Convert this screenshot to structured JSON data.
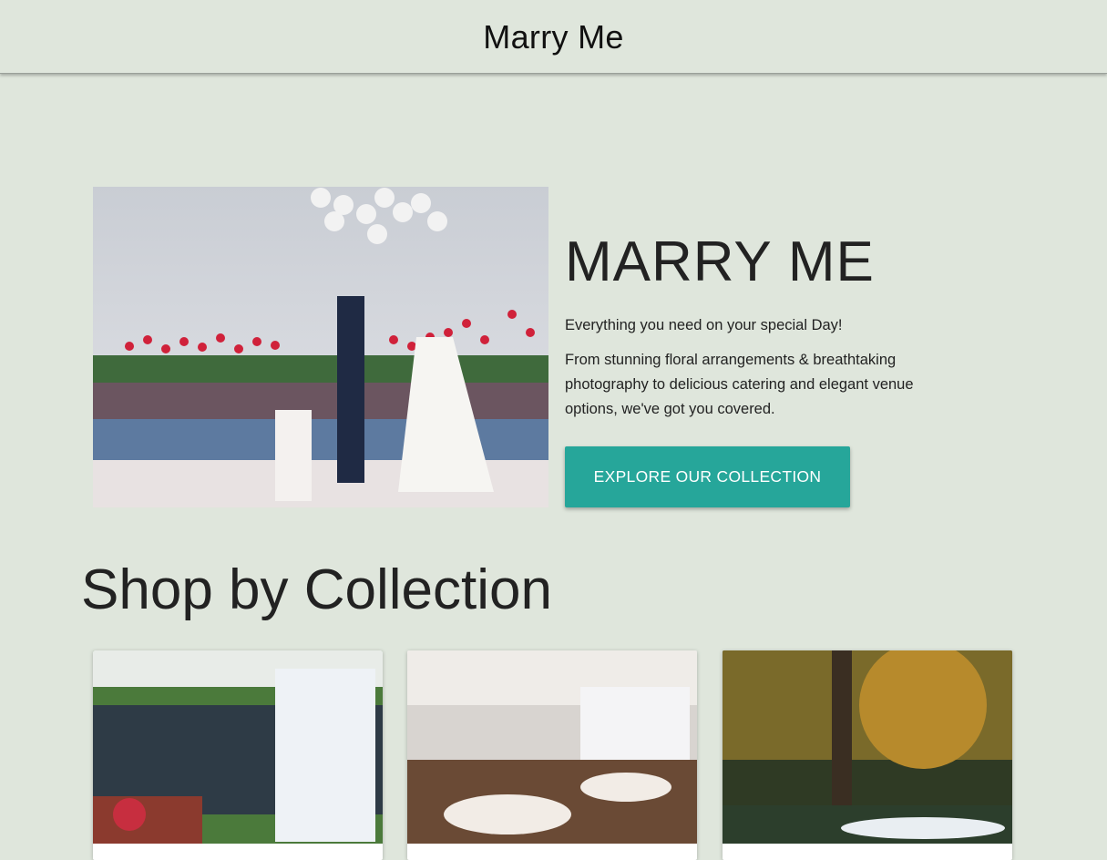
{
  "header": {
    "brand": "Marry Me"
  },
  "hero": {
    "title": "MARRY ME",
    "tagline": "Everything you need on your special Day!",
    "description": "From stunning floral arrangements & breathtaking photography to delicious catering and elegant venue options, we've got you covered.",
    "cta_label": "EXPLORE OUR COLLECTION"
  },
  "collections": {
    "title": "Shop by Collection"
  },
  "colors": {
    "background": "#dfe6dc",
    "accent": "#26a69a",
    "text": "#222222"
  }
}
